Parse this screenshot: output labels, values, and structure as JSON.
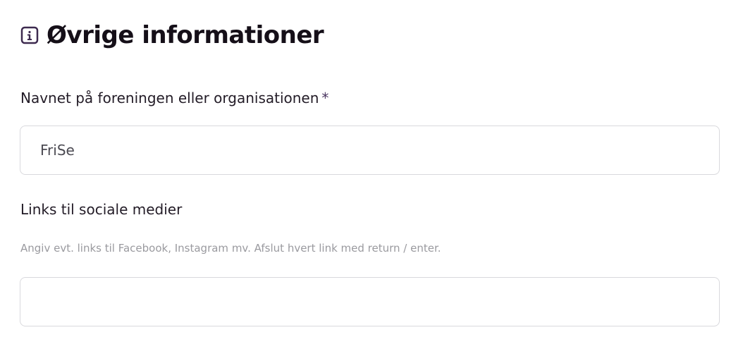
{
  "section": {
    "icon": "info-square-icon",
    "title": "Øvrige informationer"
  },
  "fields": {
    "organization": {
      "label": "Navnet på foreningen eller organisationen",
      "required_marker": "*",
      "value": "FriSe"
    },
    "social_links": {
      "label": "Links til sociale medier",
      "helper": "Angiv evt. links til Facebook, Instagram mv. Afslut hvert link med return / enter.",
      "value": ""
    }
  },
  "colors": {
    "icon_accent": "#3d2a4f",
    "border": "#d9d9dd",
    "helper_text": "#9a9a9f"
  }
}
